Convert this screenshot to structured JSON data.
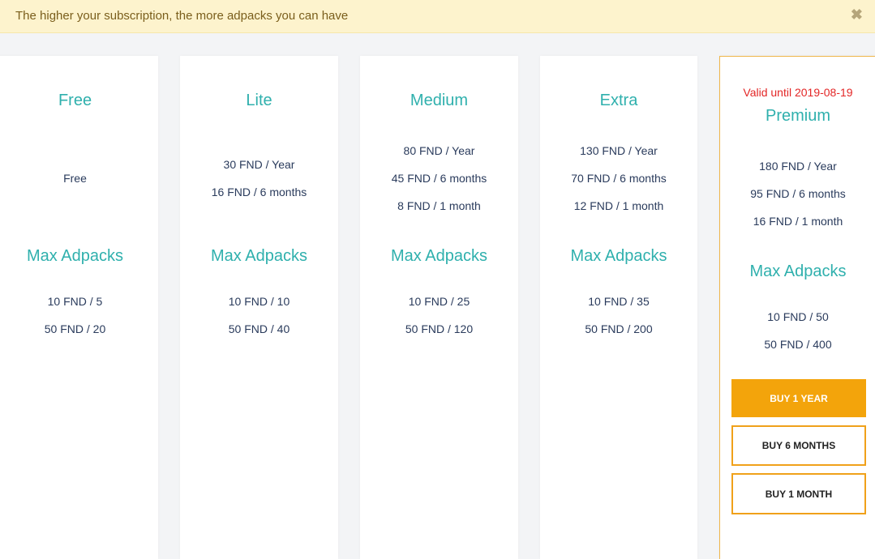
{
  "alert": {
    "message": "The higher your subscription, the more adpacks you can have",
    "close_glyph": "✖"
  },
  "section_title": "Max Adpacks",
  "plans": [
    {
      "name": "Free",
      "valid_until": "",
      "prices": [
        "Free"
      ],
      "adpacks": [
        "10 FND / 5",
        "50 FND / 20"
      ]
    },
    {
      "name": "Lite",
      "valid_until": "",
      "prices": [
        "30 FND / Year",
        "16 FND / 6 months"
      ],
      "adpacks": [
        "10 FND / 10",
        "50 FND / 40"
      ]
    },
    {
      "name": "Medium",
      "valid_until": "",
      "prices": [
        "80 FND / Year",
        "45 FND / 6 months",
        "8 FND / 1 month"
      ],
      "adpacks": [
        "10 FND / 25",
        "50 FND / 120"
      ]
    },
    {
      "name": "Extra",
      "valid_until": "",
      "prices": [
        "130 FND / Year",
        "70 FND / 6 months",
        "12 FND / 1 month"
      ],
      "adpacks": [
        "10 FND / 35",
        "50 FND / 200"
      ]
    },
    {
      "name": "Premium",
      "valid_until": "Valid until 2019-08-19",
      "prices": [
        "180 FND / Year",
        "95 FND / 6 months",
        "16 FND / 1 month"
      ],
      "adpacks": [
        "10 FND / 50",
        "50 FND / 400"
      ],
      "buttons": [
        "BUY 1 YEAR",
        "BUY 6 MONTHS",
        "BUY 1 MONTH"
      ]
    }
  ],
  "colors": {
    "accent": "#2fb0ad",
    "button": "#f3a40b",
    "valid": "#e32626",
    "alert_bg": "#fdf3cd"
  }
}
